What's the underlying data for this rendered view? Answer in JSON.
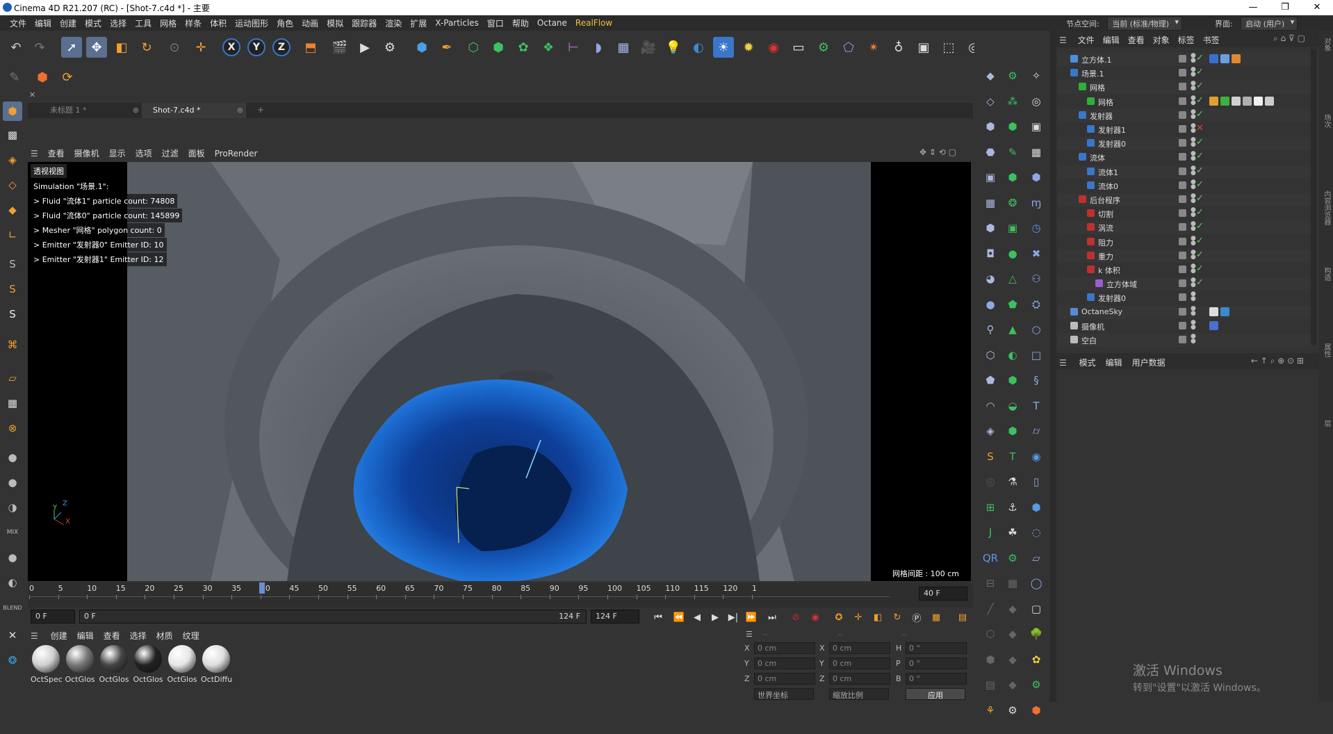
{
  "window": {
    "title": "Cinema 4D R21.207 (RC) - [Shot-7.c4d *] - 主要",
    "min": "—",
    "max": "❐",
    "close": "✕"
  },
  "menubar": {
    "items": [
      "文件",
      "编辑",
      "创建",
      "模式",
      "选择",
      "工具",
      "网格",
      "样条",
      "体积",
      "运动图形",
      "角色",
      "动画",
      "模拟",
      "跟踪器",
      "渲染",
      "扩展",
      "X-Particles",
      "窗口",
      "帮助",
      "Octane"
    ],
    "realflow": "RealFlow",
    "node_space_label": "节点空间:",
    "node_space_value": "当前 (标准/物理)",
    "interface_label": "界面:",
    "interface_value": "启动 (用户)"
  },
  "tabs": [
    {
      "label": "未标题 1 *"
    },
    {
      "label": "Shot-7.c4d *"
    }
  ],
  "tab_add": "+",
  "viewport_menu": [
    "查看",
    "摄像机",
    "显示",
    "选项",
    "过滤",
    "面板",
    "ProRender"
  ],
  "viewport": {
    "name": "透视视图",
    "grid_spacing": "网格间距 : 100 cm",
    "info": [
      "Simulation \"场景.1\":",
      " > Fluid \"流体1\" particle count: 74808",
      " > Fluid \"流体0\" particle count: 145899",
      " > Mesher \"网格\" polygon count: 0",
      " > Emitter \"发射器0\" Emitter ID: 10",
      " > Emitter \"发射器1\" Emitter ID: 12"
    ],
    "axis_y": "Y",
    "axis_z": "Z",
    "axis_x": "X"
  },
  "timeline": {
    "ticks": [
      "0",
      "5",
      "10",
      "15",
      "20",
      "25",
      "30",
      "35",
      "40",
      "45",
      "50",
      "55",
      "60",
      "65",
      "70",
      "75",
      "80",
      "85",
      "90",
      "95",
      "100",
      "105",
      "110",
      "115",
      "120",
      "1"
    ],
    "current_frame": 40,
    "end_field": "40 F"
  },
  "time_controls": {
    "start": "0 F",
    "start2": "0 F",
    "end": "124 F",
    "end2": "124 F"
  },
  "material_menu": [
    "创建",
    "编辑",
    "查看",
    "选择",
    "材质",
    "纹理"
  ],
  "materials": [
    {
      "name": "OctSpec",
      "color": "#cfcfcf"
    },
    {
      "name": "OctGlos",
      "color": "#777"
    },
    {
      "name": "OctGlos",
      "color": "#444"
    },
    {
      "name": "OctGlos",
      "color": "#222"
    },
    {
      "name": "OctGlos",
      "color": "#e6e6e6"
    },
    {
      "name": "OctDiffu",
      "color": "#dedede"
    }
  ],
  "coords": {
    "header_dash": "--",
    "rows": [
      {
        "a": "X",
        "av": "0 cm",
        "b": "X",
        "bv": "0 cm",
        "c": "H",
        "cv": "0 °"
      },
      {
        "a": "Y",
        "av": "0 cm",
        "b": "Y",
        "bv": "0 cm",
        "c": "P",
        "cv": "0 °"
      },
      {
        "a": "Z",
        "av": "0 cm",
        "b": "Z",
        "bv": "0 cm",
        "c": "B",
        "cv": "0 °"
      }
    ],
    "world": "世界坐标",
    "scale": "缩放比例",
    "apply": "应用"
  },
  "object_menu": [
    "文件",
    "编辑",
    "查看",
    "对象",
    "标签",
    "书签"
  ],
  "objects": [
    {
      "name": "立方体.1",
      "indent": 0,
      "icon": "#4a8fe0",
      "check": "ok",
      "tags": [
        "#3a6fd0",
        "#6aa0e0",
        "#e08a30"
      ]
    },
    {
      "name": "场景.1",
      "indent": 0,
      "icon": "#3a76c9",
      "check": "ok",
      "tags": []
    },
    {
      "name": "网格",
      "indent": 1,
      "icon": "#2fae3c",
      "check": "ok",
      "tags": []
    },
    {
      "name": "网格",
      "indent": 2,
      "icon": "#2fae3c",
      "check": "ok",
      "tags": [
        "#e0a030",
        "#3cb040",
        "#d0d0d0",
        "#b0b0b0",
        "#f0f0f0",
        "#cccccc"
      ]
    },
    {
      "name": "发射器",
      "indent": 1,
      "icon": "#3a76c9",
      "check": "ok",
      "tags": []
    },
    {
      "name": "发射器1",
      "indent": 2,
      "icon": "#3a76c9",
      "check": "x",
      "tags": []
    },
    {
      "name": "发射器0",
      "indent": 2,
      "icon": "#3a76c9",
      "check": "ok",
      "tags": []
    },
    {
      "name": "流体",
      "indent": 1,
      "icon": "#3a76c9",
      "check": "ok",
      "tags": []
    },
    {
      "name": "流体1",
      "indent": 2,
      "icon": "#3a76c9",
      "check": "ok",
      "tags": []
    },
    {
      "name": "流体0",
      "indent": 2,
      "icon": "#3a76c9",
      "check": "ok",
      "tags": []
    },
    {
      "name": "后台程序",
      "indent": 1,
      "icon": "#c03030",
      "check": "ok",
      "tags": []
    },
    {
      "name": "切割",
      "indent": 2,
      "icon": "#c03030",
      "check": "ok",
      "tags": []
    },
    {
      "name": "涡流",
      "indent": 2,
      "icon": "#c03030",
      "check": "ok",
      "tags": []
    },
    {
      "name": "阻力",
      "indent": 2,
      "icon": "#c03030",
      "check": "ok",
      "tags": []
    },
    {
      "name": "重力",
      "indent": 2,
      "icon": "#c03030",
      "check": "ok",
      "tags": []
    },
    {
      "name": "k 体积",
      "indent": 2,
      "icon": "#c03030",
      "check": "ok",
      "tags": []
    },
    {
      "name": "立方体域",
      "indent": 3,
      "icon": "#9a5fd0",
      "check": "ok",
      "tags": []
    },
    {
      "name": "发射器0",
      "indent": 2,
      "icon": "#3a76c9",
      "check": "none",
      "tags": []
    },
    {
      "name": "OctaneSky",
      "indent": 0,
      "icon": "#5a8ad0",
      "check": "none",
      "tags": [
        "#dddddd",
        "#3a8ad0"
      ]
    },
    {
      "name": "摄像机",
      "indent": 0,
      "icon": "#bbbbbb",
      "check": "none",
      "tags": [
        "#4a6fd0"
      ]
    },
    {
      "name": "空白",
      "indent": 0,
      "icon": "#bbbbbb",
      "check": "none",
      "tags": []
    }
  ],
  "attr_menu": [
    "模式",
    "编辑",
    "用户数据"
  ],
  "right_strip": [
    "对象",
    "场次",
    "内容浏览器",
    "构造",
    "属性",
    "层"
  ],
  "watermark": {
    "line1": "激活 Windows",
    "line2": "转到\"设置\"以激活 Windows。"
  },
  "colors": {
    "accent": "#3a76c9",
    "realflow": "#f0c040",
    "fluid": "#1a6fd8"
  }
}
